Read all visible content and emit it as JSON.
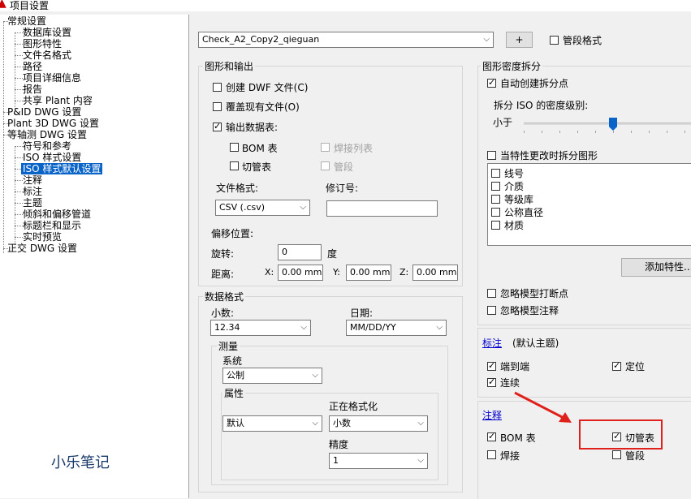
{
  "window": {
    "title": "项目设置"
  },
  "tree": {
    "items": [
      {
        "label": "常规设置"
      },
      {
        "label": "数据库设置"
      },
      {
        "label": "图形特性"
      },
      {
        "label": "文件名格式"
      },
      {
        "label": "路径"
      },
      {
        "label": "项目详细信息"
      },
      {
        "label": "报告"
      },
      {
        "label": "共享 Plant 内容"
      },
      {
        "label": "P&ID DWG 设置"
      },
      {
        "label": "Plant 3D DWG 设置"
      },
      {
        "label": "等轴测 DWG 设置"
      },
      {
        "label": "符号和参考"
      },
      {
        "label": "ISO 样式设置"
      },
      {
        "label": "ISO 样式默认设置"
      },
      {
        "label": "注释"
      },
      {
        "label": "标注"
      },
      {
        "label": "主题"
      },
      {
        "label": "倾斜和偏移管道"
      },
      {
        "label": "标题栏和显示"
      },
      {
        "label": "实时预览"
      },
      {
        "label": "正交 DWG 设置"
      }
    ],
    "selected": "ISO 样式默认设置"
  },
  "watermark": "小乐笔记",
  "top": {
    "style_value": "Check_A2_Copy2_qieguan",
    "add_button": "+",
    "segment_format_label": "管段格式",
    "segment_format_checked": false
  },
  "graphics_output": {
    "title": "图形和输出",
    "create_dwf_label": "创建 DWF 文件(C)",
    "create_dwf_checked": false,
    "overwrite_label": "覆盖现有文件(O)",
    "overwrite_checked": false,
    "output_table_label": "输出数据表:",
    "output_table_checked": true,
    "bom_label": "BOM 表",
    "bom_checked": false,
    "weld_list_label": "焊接列表",
    "weld_list_checked": false,
    "cut_table_label": "切管表",
    "cut_table_checked": false,
    "pipe_seg_label": "管段",
    "pipe_seg_checked": false,
    "file_format_label": "文件格式:",
    "file_format_value": "CSV (.csv)",
    "revision_label": "修订号:",
    "revision_value": "",
    "offset_label": "偏移位置:",
    "rotate_label": "旋转:",
    "rotate_value": "0",
    "degree_label": "度",
    "distance_label": "距离:",
    "x_label": "X:",
    "x_value": "0.00 mm",
    "y_label": "Y:",
    "y_value": "0.00 mm",
    "z_label": "Z:",
    "z_value": "0.00 mm"
  },
  "data_format": {
    "title": "数据格式",
    "decimal_label": "小数:",
    "decimal_value": "12.34",
    "date_label": "日期:",
    "date_value": "MM/DD/YY",
    "measure_title": "测量",
    "system_label": "系统",
    "system_value": "公制",
    "property_label": "属性",
    "property_value": "默认",
    "formatting_label": "正在格式化",
    "formatting_value": "小数",
    "precision_label": "精度",
    "precision_value": "1"
  },
  "density_split": {
    "title": "图形密度拆分",
    "auto_create_label": "自动创建拆分点",
    "auto_create_checked": true,
    "split_level_label": "拆分 ISO 的密度级别:",
    "less_label": "小于",
    "slider_fraction": 0.5,
    "split_on_change_label": "当特性更改时拆分图形",
    "split_on_change_checked": false,
    "list_items": [
      {
        "label": "线号",
        "checked": false
      },
      {
        "label": "介质",
        "checked": false
      },
      {
        "label": "等级库",
        "checked": false
      },
      {
        "label": "公称直径",
        "checked": false
      },
      {
        "label": "材质",
        "checked": false
      }
    ],
    "add_property_button": "添加特性...",
    "ignore_breakpoints_label": "忽略模型打断点",
    "ignore_breakpoints_checked": false,
    "ignore_annotations_label": "忽略模型注释",
    "ignore_annotations_checked": false
  },
  "dimension": {
    "link_label": "标注",
    "subtitle": "(默认主题)",
    "end_to_end_label": "端到端",
    "end_to_end_checked": true,
    "position_label": "定位",
    "position_checked": true,
    "continuous_label": "连续",
    "continuous_checked": true
  },
  "annotation": {
    "link_label": "注释",
    "bom_label": "BOM 表",
    "bom_checked": true,
    "cut_label": "切管表",
    "cut_checked": true,
    "weld_label": "焊接",
    "weld_checked": false,
    "seg_label": "管段",
    "seg_checked": false
  },
  "colors": {
    "highlight_box": "#e0201a",
    "selection": "#0a64c8"
  }
}
